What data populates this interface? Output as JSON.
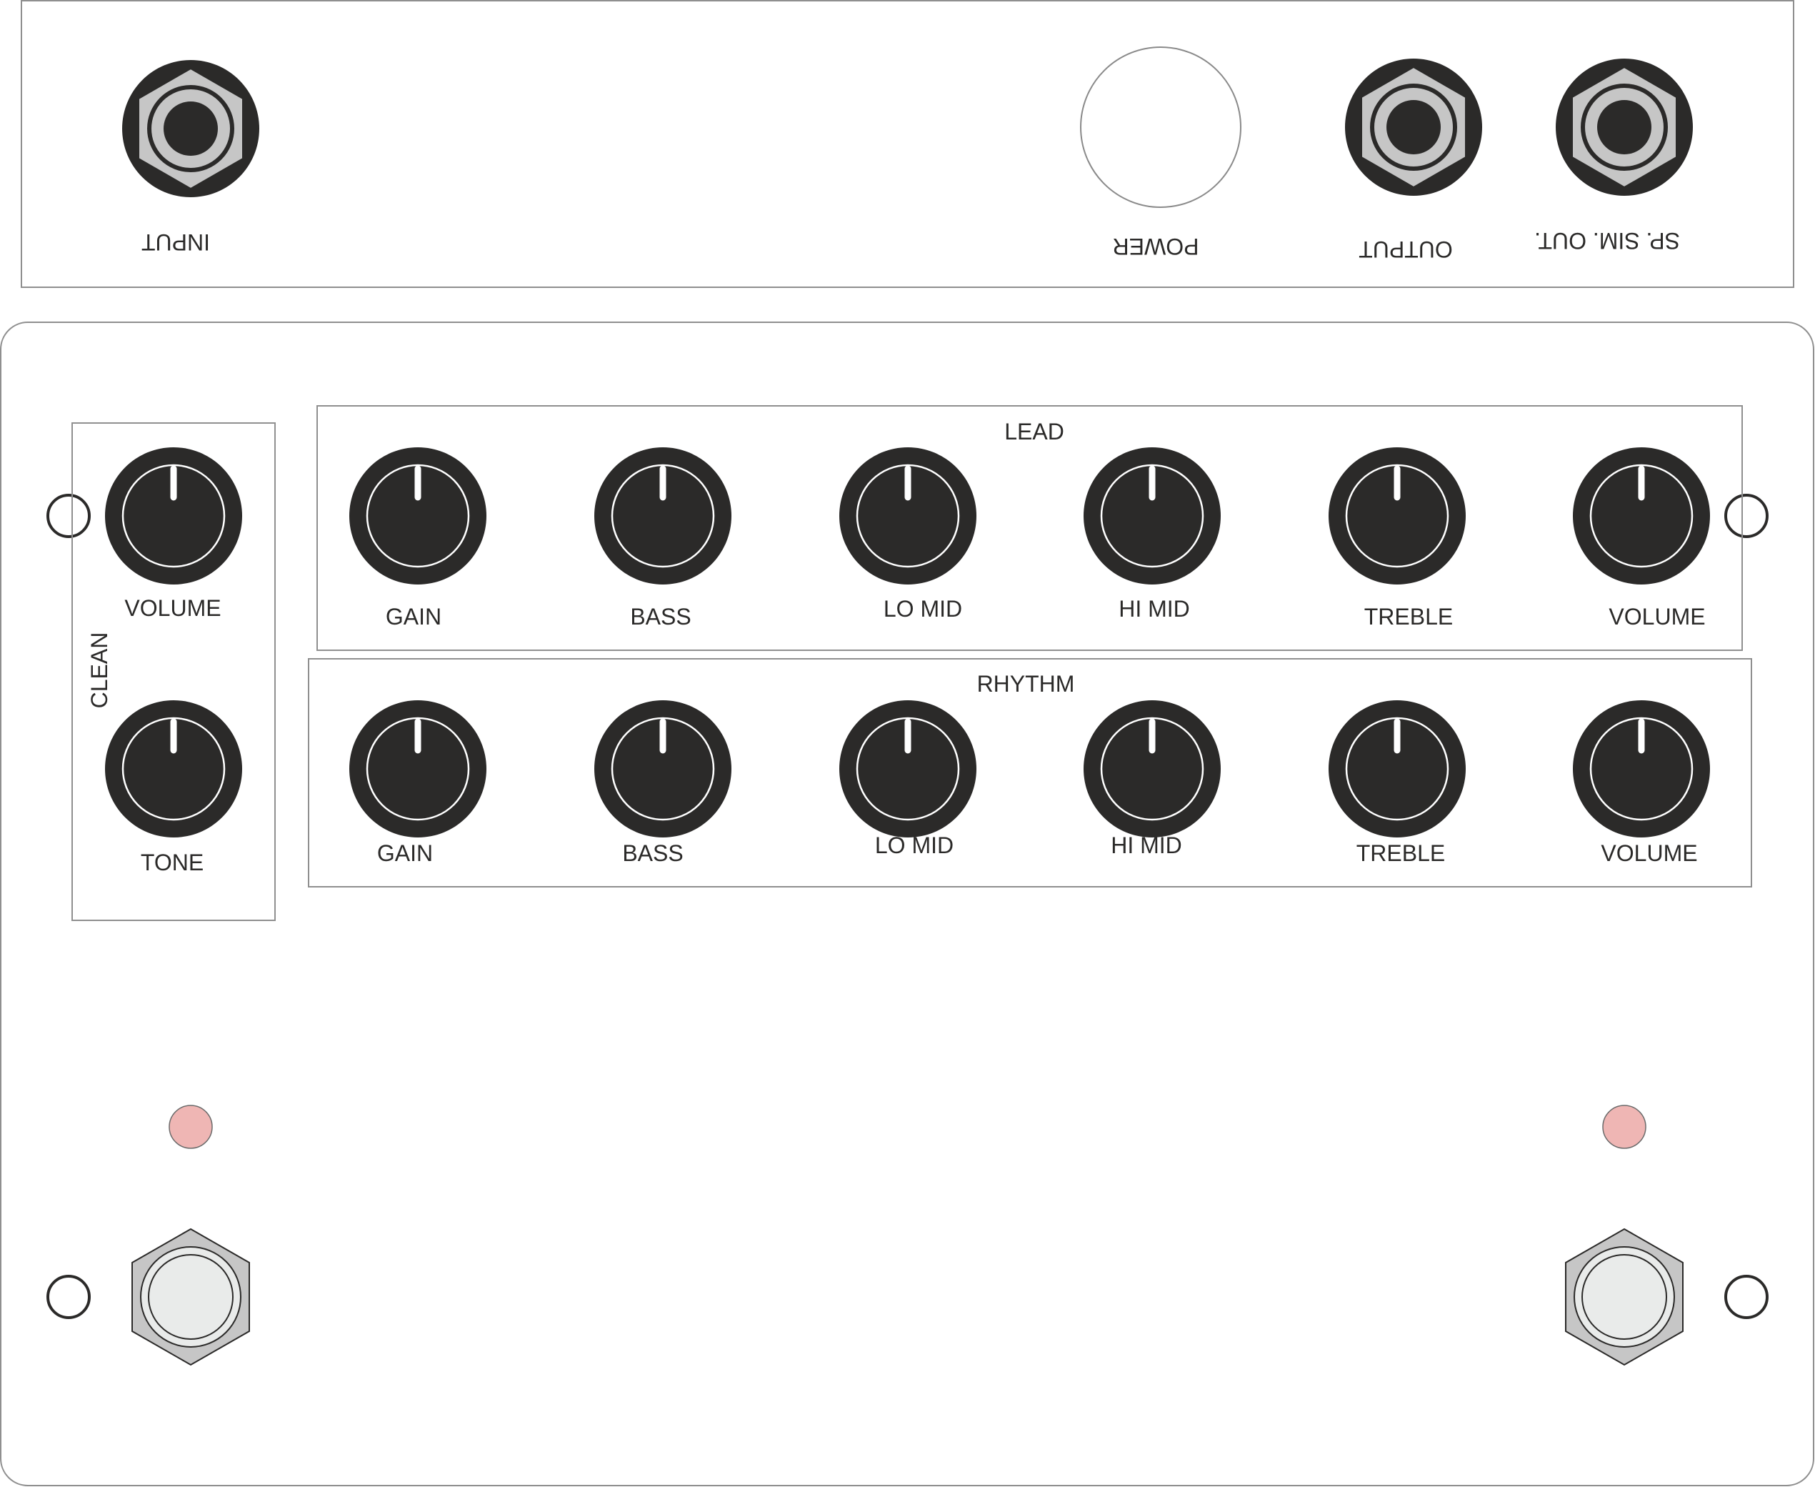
{
  "top_panel": {
    "jacks": [
      {
        "id": "input",
        "label": "INPUT"
      },
      {
        "id": "output",
        "label": "OUTPUT"
      },
      {
        "id": "sp-sim-out",
        "label": "SP. SIM. OUT."
      }
    ],
    "power_label": "POWER"
  },
  "main_panel": {
    "clean": {
      "title": "CLEAN",
      "knobs": [
        {
          "label": "VOLUME"
        },
        {
          "label": "TONE"
        }
      ]
    },
    "lead": {
      "title": "LEAD",
      "knobs": [
        {
          "label": "GAIN"
        },
        {
          "label": "BASS"
        },
        {
          "label": "LO MID"
        },
        {
          "label": "HI MID"
        },
        {
          "label": "TREBLE"
        },
        {
          "label": "VOLUME"
        }
      ]
    },
    "rhythm": {
      "title": "RHYTHM",
      "knobs": [
        {
          "label": "GAIN"
        },
        {
          "label": "BASS"
        },
        {
          "label": "LO MID"
        },
        {
          "label": "HI MID"
        },
        {
          "label": "TREBLE"
        },
        {
          "label": "VOLUME"
        }
      ]
    },
    "led_color": "#efb6b4",
    "knob_color": "#2b2a29",
    "jack_nut_color": "#c6c6c6",
    "footswitch_cap_color": "#e9ebea"
  }
}
